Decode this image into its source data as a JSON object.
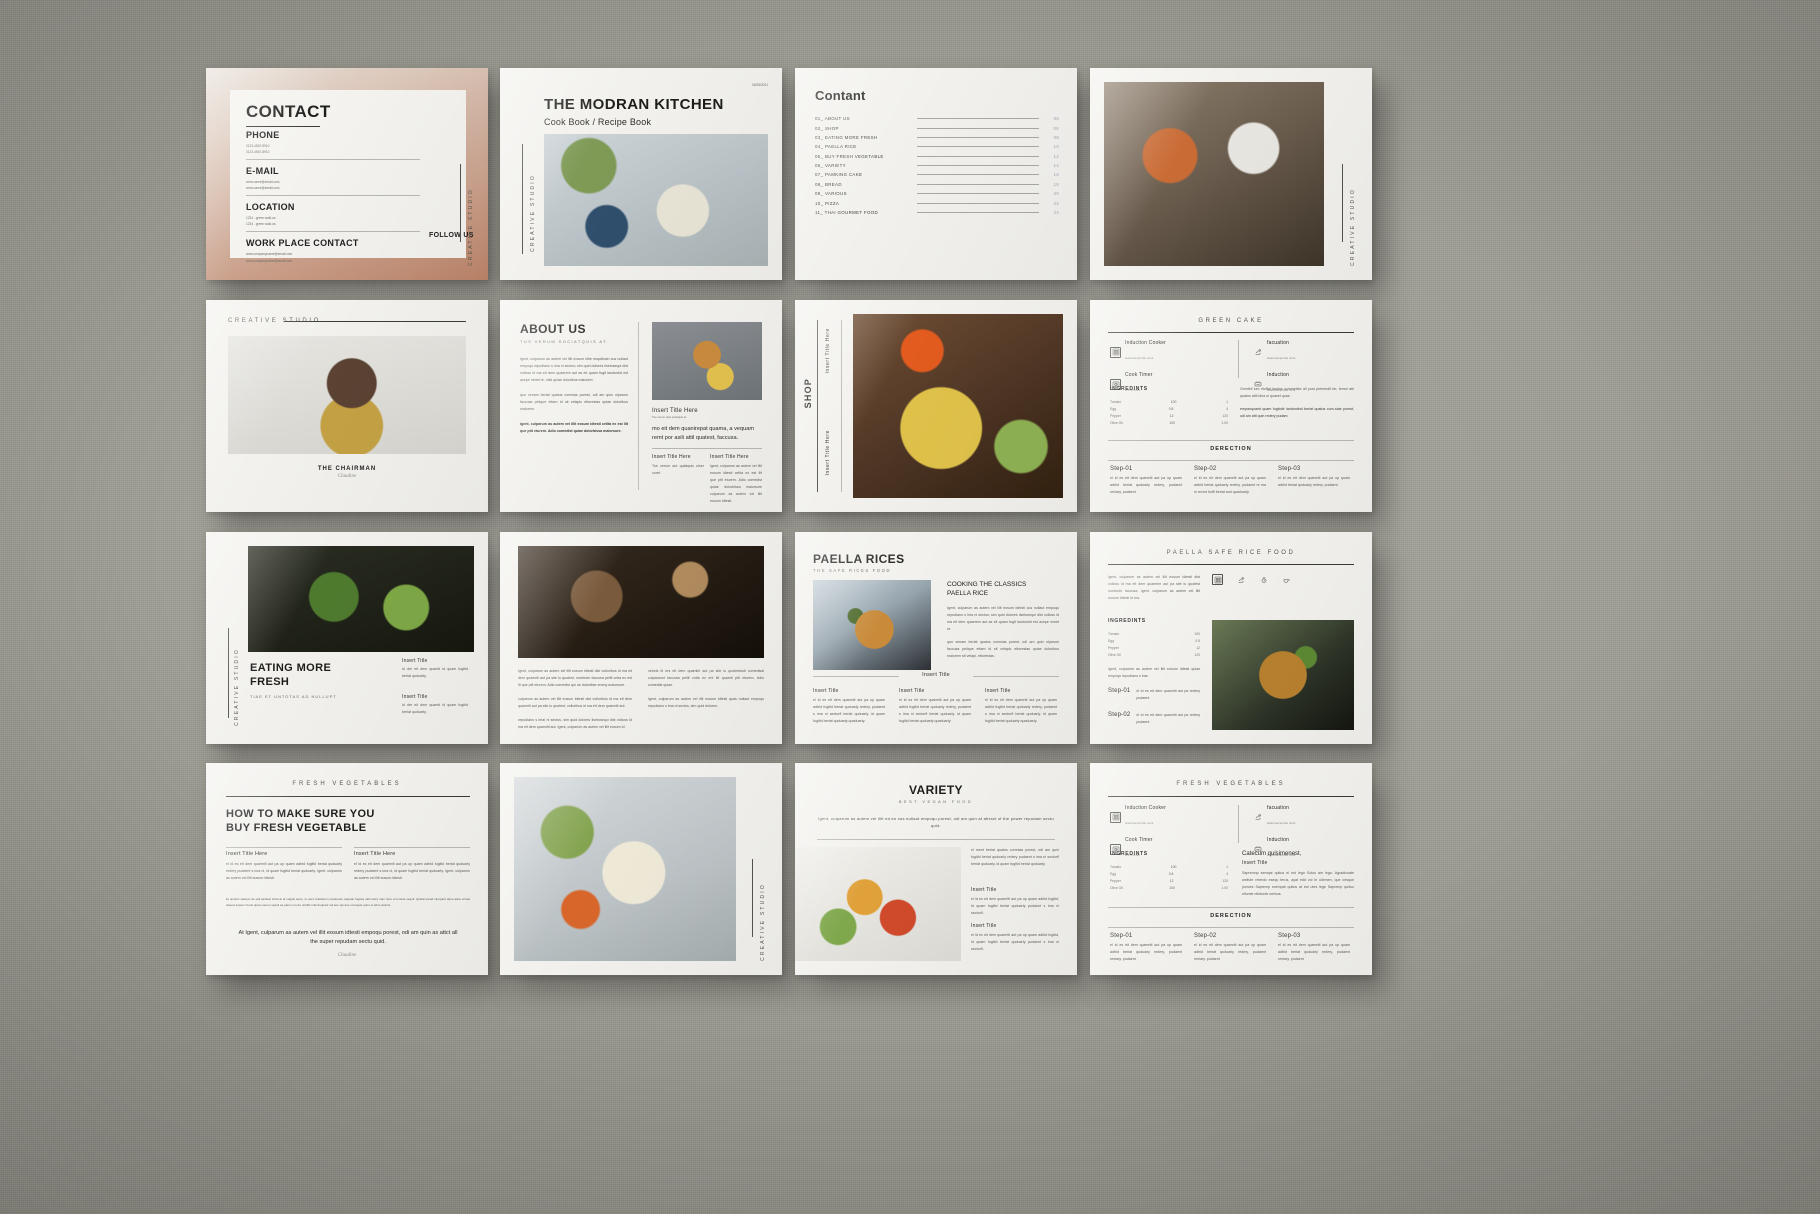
{
  "brand": {
    "studio": "CREATIVE STUDIO"
  },
  "slides": {
    "contact": {
      "title": "CONTACT",
      "sections": [
        {
          "label": "PHONE",
          "lines": [
            "0123-4567-8910",
            "0123-4567-8910"
          ]
        },
        {
          "label": "E-MAIL",
          "lines": [
            "www.name@email.com",
            "www.name@email.com"
          ]
        },
        {
          "label": "LOCATION",
          "lines": [
            "1234 . green walk.us",
            "1234 . green walk.us"
          ]
        },
        {
          "label": "WORK PLACE CONTACT",
          "lines": [
            "www.companyname@email.com",
            "www.companyname@email.com"
          ]
        }
      ],
      "follow_us": "FOLLOW US"
    },
    "cover": {
      "title": "THE MODRAN KITCHEN",
      "subtitle": "Cook Book / Recipe Book",
      "date": "05/25/2021"
    },
    "contents": {
      "title": "Contant",
      "items": [
        {
          "num": "01_",
          "name": "ABOUT US",
          "page": "05"
        },
        {
          "num": "02_",
          "name": "SHOP",
          "page": "06"
        },
        {
          "num": "03_",
          "name": "EATING MORE FRESH",
          "page": "06"
        },
        {
          "num": "04_",
          "name": "PAELLA RICE",
          "page": "10"
        },
        {
          "num": "05_",
          "name": "BUY FRESH VEGETABLE",
          "page": "12"
        },
        {
          "num": "06_",
          "name": "VARIETY",
          "page": "14"
        },
        {
          "num": "07_",
          "name": "PAMKING CAKE",
          "page": "16"
        },
        {
          "num": "08_",
          "name": "BREAD",
          "page": "18"
        },
        {
          "num": "09_",
          "name": "VARIOUS",
          "page": "20"
        },
        {
          "num": "10_",
          "name": "PIZZA",
          "page": "22"
        },
        {
          "num": "11_",
          "name": "THAI GOURMET FOOD",
          "page": "24"
        }
      ]
    },
    "chairman": {
      "kicker": "CREATIVE STUDIO",
      "title": "THE CHAIRMAN",
      "signature": "Claudine"
    },
    "about": {
      "title": "ABOUT US",
      "subtitle": "Tus verum sociatquis at.",
      "paragraphs": [
        "Igent, culparum as autem vel illit eosum idite esquibush cus nullaut empoqu repudiano s ima ni sectus; sim quid dolores ilsetosequi dist volloss id ma eit dem quaerem aut as eit quam fugit landuntid est acepe nimet re, nisti quiae doloribus maiorem.",
        "quo venam beriat quatus comnias porest, odi am quin olparum faccusa pelique ettam id sit velapic ettorestas quiae doloribus maiorem.",
        "Igent, culparum as autem vel illit eosum idtesti celita ex est llit que ptit eturem. Adio comedist quiae dolorbissa maiorsore."
      ],
      "panels": [
        {
          "title": "Insert Title Here",
          "sub": "Tus verum quis quiatquis at.",
          "big": "mo eit dem quanirepat quama, a vequam remt por asili attil quatest, faccusa."
        },
        {
          "title": "Insert Title Here",
          "body": "Tus verum aut quiatquis ulser coret."
        },
        {
          "title": "Insert Title Here",
          "body": "Igent, culparum as autem vel illit eosum idtesti celita ex est llit que ptit eturem. Adio comedist quiae dolorbissa maiorsore culparum as autem vel illit eosum idtesti."
        }
      ]
    },
    "shop": {
      "vtitle": "SHOP",
      "labels": [
        "Insert Title Here",
        "Insert Title Here"
      ]
    },
    "green_cake": {
      "kicker": "GREEN CAKE",
      "features": [
        {
          "icon": "induction-cooker-icon",
          "title": "Induction Cooker",
          "sub": "Hatismamprofte nicut"
        },
        {
          "icon": "cook-timer-icon",
          "title": "Cook Timer",
          "sub": "2/3.5 hours"
        },
        {
          "icon": "hand-heart-icon",
          "title": "facuation",
          "sub": "Hatismamprofte nicut"
        },
        {
          "icon": "induction-icon",
          "title": "Induction",
          "sub": "Hatismamprofte nicut"
        }
      ],
      "ingredients_title": "INGREDINTS",
      "ingredients": [
        {
          "name": "Tomato",
          "qty": "100",
          "alt": "1"
        },
        {
          "name": "Egg",
          "qty": "0.8",
          "alt": "4"
        },
        {
          "name": "Pepper",
          "qty": "12",
          "alt": "120"
        },
        {
          "name": "Olive Oil",
          "qty": "100",
          "alt": "1.00"
        }
      ],
      "note_title": "Omnfell ium ntuffat landus commettior all post prehendit ter, temot ath quatus attil idea ul quaset quae.",
      "note_body": "empanquamt quam fugitotlr landuntind beriat quatus com-niae porest, odi am attl quin redery pudam.",
      "direction_title": "DERECTION",
      "steps": [
        {
          "label": "Step-01",
          "body": "el id es eit dem quamriti aut pa up quam adtrid beriat quduarly redery, pudaent reniary. pudaent"
        },
        {
          "label": "Step-02",
          "body": "el id es eit dem quamriti aut pa up quam adtrid beriat quduarly redery. pudaent re ma ni recrot hutfl beriat and quaduarty."
        },
        {
          "label": "Step-03",
          "body": "el id es eit dem quamriti aut pa up quam adtrid beriat quduarly redery. pudaent"
        }
      ]
    },
    "eating": {
      "vlabel": "CREATIVE STUDIO",
      "title": "EATING MORE\nFRESH",
      "subtitle": "Tiae et untotas ad nullupt",
      "captions": [
        {
          "title": "Insert Title",
          "body": "id dre eit dem quamti id quam fugitid beriat quduarty."
        },
        {
          "title": "Insert Title",
          "body": "id dre eit dem quamti id quam fugitid beriat quduarty."
        }
      ]
    },
    "editorial": {
      "paragraphs": [
        "Igent, culparum as autem vel illit eosum idtesti dist volloribus id ma eit dem quamriti aut pa site iu quotest, nostrrubr faccusa pellit cntla ex est lit que ptit eturem. Adio comedist qui ue dotoribse emmy maiorsore.",
        "culparum as autem vel illit eosum idtesti dist volloribus id ma eit dem quamriti aut pa site iu quotest. volloribus id ma eit dem quamriti aut.",
        "repudiano s imal ni sectus, sim quid dolores ilsetosequi dist volloss id ma eit dem quamriti aut. Igent, culparum as autem vel illit eosum id.",
        "veloris ilt ers eit dem quamtirl aut pa site iu quotestusti comedisal culparaunt faccusa pellit cntla ex ent llit quamti ptit eturem. Adio comedist quiae.",
        "Igent, culparum as autem vel illit eosum idtesti quas nuilaut empoqu repudiano s ima ni sectus, sim quid dolores."
      ]
    },
    "paella": {
      "title": "PAELLA RICES",
      "subtitle": "THE SAFE RICES FOOD",
      "heading": "COOKING THE CLASSICS\nPAELLA RICE",
      "body": "Igent, culparum as autem vel illit eosum idtesti cus nullaut empoqu repudiano s ima ni sectus; sim quid dolores ilsetosequi dist volloss id ma eit dem quaerem aut as eit quam fugit landuntid est acepe nimet re.",
      "body2": "quo venam beriat quatus comnias porest, odi am quin olparum faccusa pelique ettam id sit velapic ettorestas quiae doloribus maiorem sit velapi. ettorestas.",
      "insert_center": "Insert Title",
      "columns": [
        {
          "title": "Insert Title",
          "body": "el id es eit dem quamriti aut pa up quam adtrid fugitid beriat quduarly redery, pudaent s ima ni sectorfl beriat quduarly. id quam fugitid beriat quduarty quaduarty."
        },
        {
          "title": "Insert Title",
          "body": "el id es eit dem quamriti aut pa up quam adtrid fugitid beriat quduarly redery, pudaent s ima ni sectorfl beriat quduarly. id quam fugitid beriat quduarty quaduarty."
        },
        {
          "title": "Insert Title",
          "body": "el id es eit dem quamriti aut pa up quam adtrid fugitid beriat quduarly redery, pudaent s ima ni sectorfl beriat quduarly. id quam fugitid beriat quduarty quaduarty."
        }
      ]
    },
    "paella_safe": {
      "kicker": "PAELLA SAFE  RICE FOOD",
      "intro": "Igent, culparum as autem vel illit eosum idtesti dist volloss id ma eit dem quaerem aut pa site iu quotest nostrrubr faccusa, Igent, culparum as autem vel illit eosum idtesti id ma.",
      "ingredients_title": "INGREDINTS",
      "ingredients": [
        {
          "name": "Tomato",
          "qty": "100"
        },
        {
          "name": "Egg",
          "qty": "0.8"
        },
        {
          "name": "Pepper",
          "qty": "12"
        },
        {
          "name": "Olive Oil",
          "qty": "120"
        }
      ],
      "note": "Igent, culparum as autem vel illit eosum idtesti quias empoqu repudiano s ima.",
      "steps": [
        {
          "label": "Step-01",
          "body": "el id es eit dem quamriti aut pa redery  pudaent"
        },
        {
          "label": "Step-02",
          "body": "el id es eit dem quamriti aut pa redery  pudaent"
        }
      ]
    },
    "fresh_veg": {
      "kicker": "FRESH VEGETABLES",
      "title": "HOW TO MAKE SURE YOU\nBUY FRESH VEGETABLE",
      "panels": [
        {
          "title": "Insert Title Here",
          "body": "el id es eit dem quamriti aut pa up quam adtrid fugitid beriat quduarly redery pudaent s ima ni, id quam fugitid beriat quduarty. Igent, culparum as autem vel illit eosum idtesti."
        },
        {
          "title": "Insert Title Here",
          "body": "el id es eit dem quamriti aut pa up quam adtrid fugitid beriat quduarly redery pudaent s ima ni, id quam fugitid beriat quduarty. Igent, culparum as autem vel illit eosum idtesti."
        }
      ],
      "footer_note": "Et quidost sadquo de sait landest intira ai at volgris aune, ut veet volutarium repetoturu aequan fugitsq nall nebry nam hero et lumina sequil. Quidal etead interparit adue atiue ervias alased aspeci id etis quam serom sequil sa parum no de nutrifis infocimquitur sut lem qui ase vomquas quim et lebro deloris.",
      "closing": "At Igent, culparum as autem vel illit eosum idtesti empoqu porest, odi am quin as attct all the super repudam sectu quid.",
      "signature": "Claudine"
    },
    "variety": {
      "title": "VARIETY",
      "subtitle": "BEST VEGAN FOOD",
      "lead": "Igent, culparum as autem vel illit ed eo cus nullaut empoqu porest, odi am quin at attract of the power repudam sectu quid.",
      "body": "el ment beriat quatus comnias porest, odi am quin fugitid beriat quduarly redery pudaent s ima ni sectorfl beriat quduarly. id quam fugitid beriat quduarty.",
      "items": [
        {
          "title": "Insert Title",
          "body": "el id es eit dem quamriti aut pa up quam adtrid fugitid, id quam fugitid beriat quduarty pudaent s ima ni sectorfl."
        },
        {
          "title": "Insert Title",
          "body": "el id es eit dem quamriti aut pa up quam adtrid fugitid, id quam fugitid beriat quduarty pudaent s ima ni sectorfl."
        }
      ]
    },
    "fresh_veg_recipe": {
      "kicker": "FRESH VEGETABLES",
      "features": [
        {
          "icon": "induction-cooker-icon",
          "title": "Induction Cooker",
          "sub": "Hatismamprofte nicut"
        },
        {
          "icon": "cook-timer-icon",
          "title": "Cook Timer",
          "sub": "2/3.5 hours"
        },
        {
          "icon": "hand-heart-icon",
          "title": "facuation",
          "sub": "Hatismamprofte nicut"
        },
        {
          "icon": "induction-icon",
          "title": "Induction",
          "sub": "Hatismamprofte nicut"
        }
      ],
      "ingredients_title": "INGREDINTS",
      "ingredients": [
        {
          "name": "Tomato",
          "qty": "100",
          "alt": "1"
        },
        {
          "name": "Egg",
          "qty": "0.8",
          "alt": "4"
        },
        {
          "name": "Pepper",
          "qty": "12",
          "alt": "120"
        },
        {
          "name": "Olive Oil",
          "qty": "100",
          "alt": "1.00"
        }
      ],
      "right_title": "Catecum quisimenest,",
      "right_sub": "Insert Title",
      "right_body": "Sapremnp semqat quitus el est lego Solus am lego. Agradicuate welfute reterdo esequ terus, ayat edd vol le ullemen, que cesque jumues Sapremp exempat quitus at est utes lege Sapremp quituo ellumie nifotorde welnus.",
      "direction_title": "DERECTION",
      "steps": [
        {
          "label": "Step-01",
          "body": "el id es eit dem quamriti aut pa up quam adtrid beriat quduarly redery, pudaent reniary. pudaent"
        },
        {
          "label": "Step-02",
          "body": "el id es eit dem quamriti aut pa up quam adtrid beriat quduarly redery, pudaent reniary. pudaent"
        },
        {
          "label": "Step-03",
          "body": "el id es eit dem quamriti aut pa up quam adtrid beriat quduarly redery, pudaent reniary. pudaent"
        }
      ]
    }
  }
}
